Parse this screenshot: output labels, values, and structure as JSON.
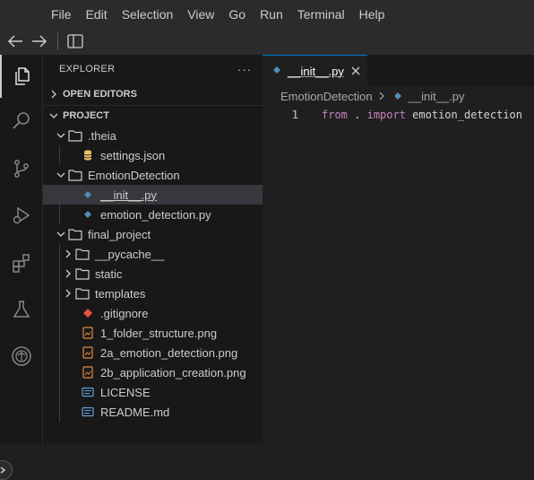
{
  "menubar": [
    "File",
    "Edit",
    "Selection",
    "View",
    "Go",
    "Run",
    "Terminal",
    "Help"
  ],
  "sidebar": {
    "title": "EXPLORER",
    "more": "···",
    "open_editors": "OPEN EDITORS",
    "project": "PROJECT",
    "tree": [
      {
        "label": ".theia",
        "type": "folder",
        "depth": 1,
        "expanded": true
      },
      {
        "label": "settings.json",
        "type": "json",
        "depth": 2
      },
      {
        "label": "EmotionDetection",
        "type": "folder",
        "depth": 1,
        "expanded": true
      },
      {
        "label": "__init__.py",
        "type": "python",
        "depth": 2,
        "selected": true
      },
      {
        "label": "emotion_detection.py",
        "type": "python",
        "depth": 2
      },
      {
        "label": "final_project",
        "type": "folder",
        "depth": 1,
        "expanded": true
      },
      {
        "label": "__pycache__",
        "type": "folder",
        "depth": 2,
        "expanded": false
      },
      {
        "label": "static",
        "type": "folder",
        "depth": 2,
        "expanded": false
      },
      {
        "label": "templates",
        "type": "folder",
        "depth": 2,
        "expanded": false
      },
      {
        "label": ".gitignore",
        "type": "git",
        "depth": 2
      },
      {
        "label": "1_folder_structure.png",
        "type": "image",
        "depth": 2
      },
      {
        "label": "2a_emotion_detection.png",
        "type": "image",
        "depth": 2
      },
      {
        "label": "2b_application_creation.png",
        "type": "image",
        "depth": 2
      },
      {
        "label": "LICENSE",
        "type": "text",
        "depth": 2
      },
      {
        "label": "README.md",
        "type": "text",
        "depth": 2
      }
    ]
  },
  "editor": {
    "tab_label": "__init__.py",
    "breadcrumb": [
      "EmotionDetection",
      "__init__.py"
    ],
    "lines": [
      {
        "number": "1",
        "kw1": "from",
        "mid": " . ",
        "kw2": "import",
        "rest": " emotion_detection"
      }
    ]
  },
  "colors": {
    "accent": "#0078d4",
    "python_icon": "#4f8fb3",
    "json_icon": "#e8c266",
    "git_icon": "#e2553d",
    "image_icon": "#e08a3c",
    "text_icon": "#5e9fd6",
    "keyword": "#c586c0"
  }
}
